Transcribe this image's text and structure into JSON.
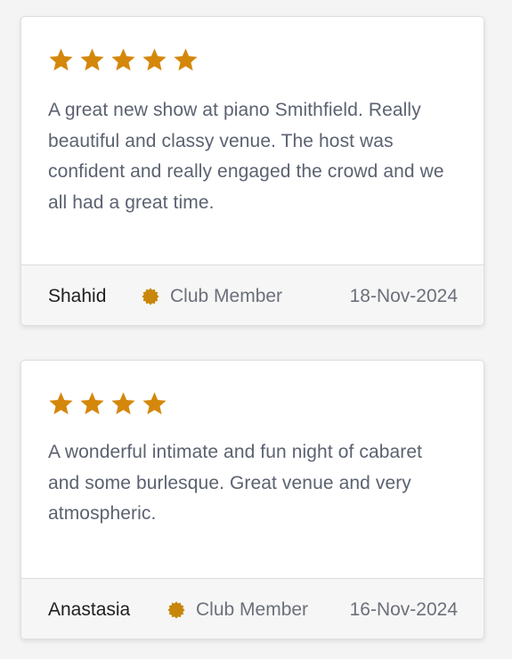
{
  "colors": {
    "star": "#d4870a",
    "badge": "#c8860a",
    "text": "#5b6270",
    "name": "#1f1f1f"
  },
  "reviews": [
    {
      "rating": 5,
      "text": "A great new show at piano Smithfield. Really beautiful and classy venue. The host was confident and really engaged the crowd and we all had a great time.",
      "name": "Shahid",
      "badge_icon": "star-badge-icon",
      "badge_label": "Club Member",
      "date": "18-Nov-2024"
    },
    {
      "rating": 4,
      "text": "A wonderful intimate and fun night of cabaret and some burlesque. Great venue and very atmospheric.",
      "name": "Anastasia",
      "badge_icon": "star-badge-icon",
      "badge_label": "Club Member",
      "date": "16-Nov-2024"
    }
  ]
}
